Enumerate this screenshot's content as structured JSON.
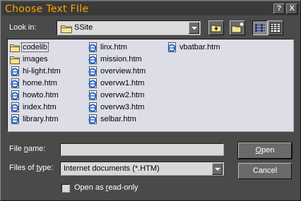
{
  "window": {
    "title": "Choose Text FIle",
    "help_label": "?",
    "close_label": "X"
  },
  "look_in": {
    "label": "Look in:",
    "value": "SSite"
  },
  "toolbar": {
    "up_folder_icon": "up-folder-icon",
    "new_folder_icon": "new-folder-icon",
    "list_view_icon": "list-view-icon",
    "details_view_icon": "details-view-icon"
  },
  "files": [
    {
      "name": "codelib",
      "type": "folder"
    },
    {
      "name": "images",
      "type": "folder"
    },
    {
      "name": "hi-light.htm",
      "type": "htm"
    },
    {
      "name": "home.htm",
      "type": "htm"
    },
    {
      "name": "howto.htm",
      "type": "htm"
    },
    {
      "name": "index.htm",
      "type": "htm"
    },
    {
      "name": "library.htm",
      "type": "htm"
    },
    {
      "name": "linx.htm",
      "type": "htm"
    },
    {
      "name": "mission.htm",
      "type": "htm"
    },
    {
      "name": "overview.htm",
      "type": "htm"
    },
    {
      "name": "overvw1.htm",
      "type": "htm"
    },
    {
      "name": "overvw2.htm",
      "type": "htm"
    },
    {
      "name": "overvw3.htm",
      "type": "htm"
    },
    {
      "name": "selbar.htm",
      "type": "htm"
    },
    {
      "name": "vbatbar.htm",
      "type": "htm"
    }
  ],
  "file_name": {
    "label": "File name:",
    "value": ""
  },
  "file_type": {
    "label": "Files of type:",
    "value": "Internet documents (*.HTM)"
  },
  "buttons": {
    "open": "Open",
    "cancel": "Cancel"
  },
  "read_only": {
    "label": "Open as read-only",
    "checked": false
  },
  "colors": {
    "title_text": "#ffa400",
    "dialog_bg": "#4a4a4a",
    "list_bg": "#dddde8"
  }
}
